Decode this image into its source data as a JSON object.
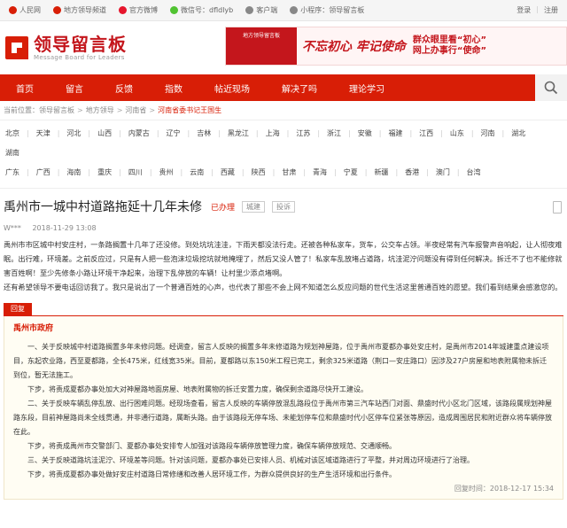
{
  "topbar": {
    "links": [
      {
        "label": "人民网",
        "icon": "people-icon",
        "color": "#d81e06"
      },
      {
        "label": "地方领导频道",
        "icon": "channel-icon",
        "color": "#d81e06"
      },
      {
        "label": "官方微博",
        "icon": "weibo-icon",
        "color": "#e6162d"
      },
      {
        "label": "微信号：dfldlyb",
        "icon": "wechat-icon",
        "color": "#51c332"
      },
      {
        "label": "客户端",
        "icon": "phone-icon",
        "color": "#888888"
      },
      {
        "label": "小程序：领导留言板",
        "icon": "miniapp-icon",
        "color": "#888888"
      }
    ],
    "login": "登录",
    "register": "注册"
  },
  "logo": {
    "cn": "领导留言板",
    "en": "Message Board for Leaders"
  },
  "banner": {
    "tag": "地方领导留言板",
    "slogan": "不忘初心  牢记使命",
    "sub1": "群众眼里看“初心”",
    "sub2": "网上办事行“使命”"
  },
  "nav": [
    "首页",
    "留言",
    "反馈",
    "指数",
    "帖近现场",
    "解决了吗",
    "理论学习"
  ],
  "breadcrumb": {
    "prefix": "当前位置：",
    "items": [
      "领导留言板",
      "地方领导",
      "河南省",
      "河南省委书记王国生"
    ]
  },
  "regions": [
    "北京",
    "天津",
    "河北",
    "山西",
    "内蒙古",
    "辽宁",
    "吉林",
    "黑龙江",
    "上海",
    "江苏",
    "浙江",
    "安徽",
    "福建",
    "江西",
    "山东",
    "河南",
    "湖北",
    "湖南",
    "广东",
    "广西",
    "海南",
    "重庆",
    "四川",
    "贵州",
    "云南",
    "西藏",
    "陕西",
    "甘肃",
    "青海",
    "宁夏",
    "新疆",
    "香港",
    "澳门",
    "台湾"
  ],
  "post": {
    "title": "禹州市一城中村道路拖延十几年未修",
    "status": "已办理",
    "tags": [
      "城建",
      "投诉"
    ],
    "author": "W***",
    "time": "2018-11-29 13:08",
    "body": [
      "禹州市市区城中村安庄村，一条路搁置十几年了还没修。到处坑坑洼洼，下雨天都没法行走。还被各种私家车，货车，公交车占领。半夜经常有汽车报警声音响起，让人彻夜难眠。出行难，环境差。之前反应过，只是有人把一些泡沫垃圾挖坑就地掩埋了，然后又没人管了！私家车乱放堵占道路，坑洼泥泞问题没有得到任何解决。拆迁不了也不能修就害百姓啊！至少先修条小路让环境干净起来，治理下乱停放的车辆！让村里少添点堵啊。",
      "还有希望领导不要电话回访我了。我只是说出了一个普通百姓的心声，也代表了那些不会上网不知道怎么反应问题的世代生活这里普通百姓的愿望。我们看到结果会感激您的。"
    ]
  },
  "reply": {
    "label": "回复",
    "org": "禹州市政府",
    "paragraphs": [
      "一、关于反映城中村道路搁置多年未修问题。经调查，留言人反映的搁置多年未修道路为规划神屋路，位于禹州市夏都办事处安庄村，是禹州市2014年城建重点建设项目，东起农业路，西至夏都路，全长475米，红线宽35米。目前，夏都路以东150米工程已完工，剩余325米道路（荆口—安庄路口）因涉及27户房屋和地表附属物未拆迁到位，暂无法施工。",
      "下步，将责成夏都办事处加大对神屋路地面房屋、地表附属物的拆迁安置力度，确保剩余道路尽快开工建设。",
      "二、关于反映车辆乱停乱放、出行困难问题。经现场查看，留言人反映的车辆停放混乱路段位于禹州市第三汽车站西门对面、鼎盛时代小区北门区域，该路段属规划神屋路东段，目前神屋路尚未全线贯通，并非通行道路，属断头路。由于该路段无停车场、未能划停车位和鼎盛时代小区停车位紧张等原因，造成周围居民和附近群众将车辆停放在此。",
      "下步，将责成禹州市交警部门、夏都办事处安排专人加强对该路段车辆停放管理力度，确保车辆停放规范、交通顺畅。",
      "三、关于反映道路坑洼泥泞、环境差等问题。针对该问题，夏都办事处已安排人员、机械对该区域道路进行了平整，并对周边环境进行了治理。",
      "下步，将责成夏都办事处做好安庄村道路日常修缮和改善人居环境工作，为群众提供良好的生产生活环境和出行条件。"
    ],
    "time": "回复时间：2018-12-17 15:34"
  }
}
